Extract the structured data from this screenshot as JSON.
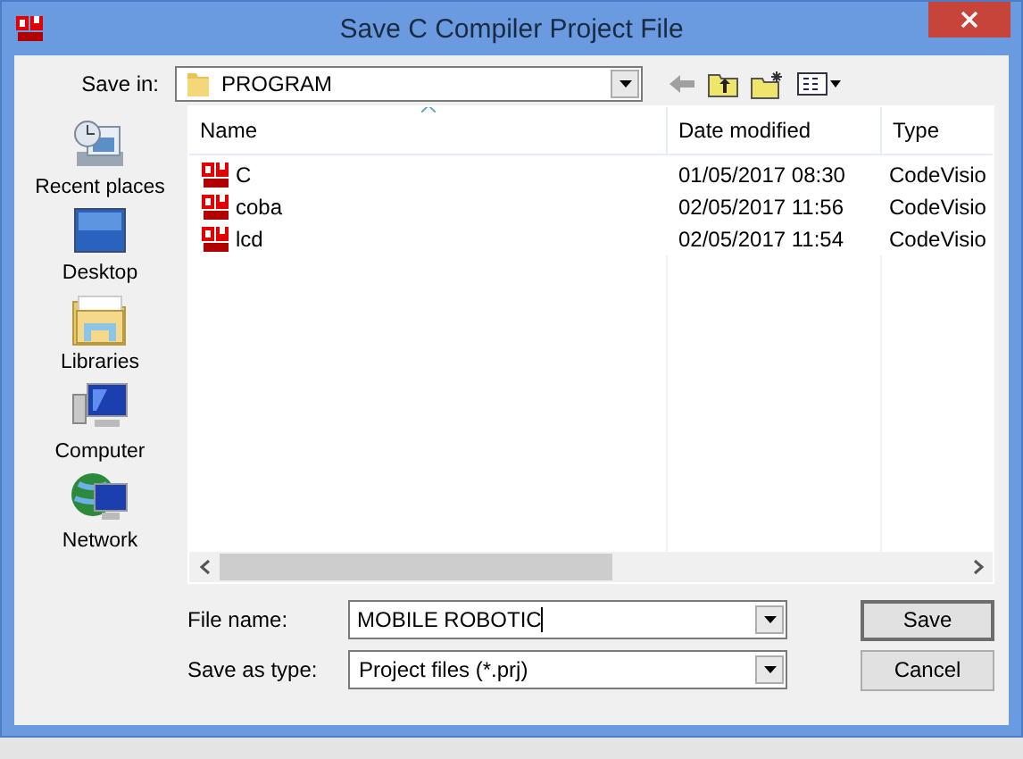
{
  "window": {
    "title": "Save C Compiler Project File"
  },
  "save_in": {
    "label": "Save in:",
    "value": "PROGRAM"
  },
  "places": [
    {
      "label": "Recent places",
      "kind": "recent"
    },
    {
      "label": "Desktop",
      "kind": "desktop"
    },
    {
      "label": "Libraries",
      "kind": "libraries"
    },
    {
      "label": "Computer",
      "kind": "computer"
    },
    {
      "label": "Network",
      "kind": "network"
    }
  ],
  "columns": [
    {
      "label": "Name",
      "sorted": true
    },
    {
      "label": "Date modified",
      "sorted": false
    },
    {
      "label": "Type",
      "sorted": false
    }
  ],
  "files": [
    {
      "name": "C",
      "date": "01/05/2017 08:30",
      "type": "CodeVisio"
    },
    {
      "name": "coba",
      "date": "02/05/2017 11:56",
      "type": "CodeVisio"
    },
    {
      "name": "lcd",
      "date": "02/05/2017 11:54",
      "type": "CodeVisio"
    }
  ],
  "file_name": {
    "label": "File name:",
    "value": "MOBILE ROBOTIC"
  },
  "save_as_type": {
    "label": "Save as type:",
    "value": "Project files (*.prj)"
  },
  "buttons": [
    {
      "label": "Save",
      "default": true
    },
    {
      "label": "Cancel",
      "default": false
    }
  ]
}
